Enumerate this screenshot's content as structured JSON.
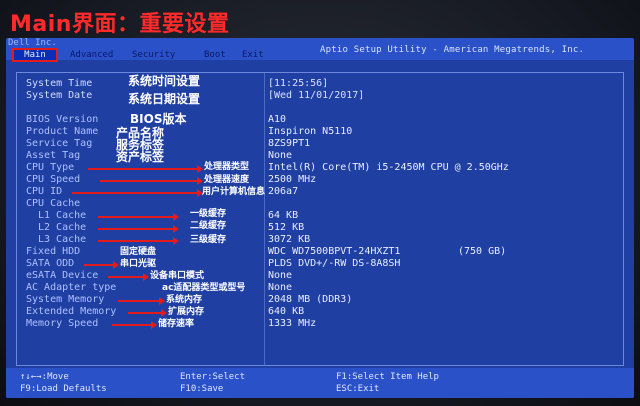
{
  "title": "Main界面：重要设置",
  "header": {
    "brand": "Dell Inc.",
    "utility": "Aptio Setup Utility - American Megatrends, Inc.",
    "tabs": [
      "Main",
      "Advanced",
      "Security",
      "Boot",
      "Exit"
    ]
  },
  "rows": [
    {
      "label": "System Time",
      "value": "[11:25:56]",
      "annotation": "系统时间设置"
    },
    {
      "label": "System Date",
      "value": "[Wed 11/01/2017]",
      "annotation": "系统日期设置"
    },
    {
      "label": "BIOS Version",
      "value": "A10",
      "annotation": "BIOS版本"
    },
    {
      "label": "Product Name",
      "value": "Inspiron N5110",
      "annotation": "产品名称"
    },
    {
      "label": "Service Tag",
      "value": "8ZS9PT1",
      "annotation": "服务标签"
    },
    {
      "label": "Asset Tag",
      "value": "None",
      "annotation": "资产标签"
    },
    {
      "label": "CPU Type",
      "value": "Intel(R) Core(TM) i5-2450M CPU @ 2.50GHz",
      "annotation": "处理器类型"
    },
    {
      "label": "CPU Speed",
      "value": "2500 MHz",
      "annotation": "处理器速度"
    },
    {
      "label": "CPU ID",
      "value": "206a7",
      "annotation": "用户计算机信息"
    },
    {
      "label": "CPU Cache",
      "value": "",
      "annotation": ""
    },
    {
      "label": "L1 Cache",
      "value": "64 KB",
      "annotation": "一级缓存"
    },
    {
      "label": "L2 Cache",
      "value": "512 KB",
      "annotation": "二级缓存"
    },
    {
      "label": "L3 Cache",
      "value": "3072 KB",
      "annotation": "三级缓存"
    },
    {
      "label": "Fixed HDD",
      "value": "WDC WD7500BPVT-24HXZT1",
      "annotation": "固定硬盘",
      "extra": "(750 GB)"
    },
    {
      "label": "SATA ODD",
      "value": "PLDS DVD+/-RW DS-8A8SH",
      "annotation": "串口光驱"
    },
    {
      "label": "eSATA Device",
      "value": "None",
      "annotation": "设备串口模式"
    },
    {
      "label": "AC Adapter type",
      "value": "None",
      "annotation": "ac适配器类型或型号"
    },
    {
      "label": "System Memory",
      "value": "2048 MB (DDR3)",
      "annotation": "系统内存"
    },
    {
      "label": "Extended Memory",
      "value": "640 KB",
      "annotation": "扩展内存"
    },
    {
      "label": "Memory Speed",
      "value": "1333 MHz",
      "annotation": "储存速率"
    }
  ],
  "footer": {
    "move": "↑↓←→:Move",
    "select": "Enter:Select",
    "select_item": "F1:Select Item Help",
    "load": "F9:Load Defaults",
    "save": "F10:Save",
    "exit": "ESC:Exit"
  }
}
